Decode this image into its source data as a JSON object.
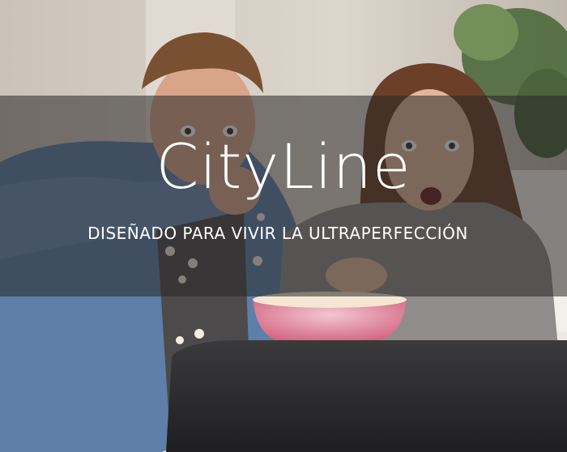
{
  "hero": {
    "title": "CityLine",
    "tagline": "DISEÑADO PARA VIVIR LA ULTRAPERFECCIÓN",
    "image": {
      "subject": "man-and-woman-eating-popcorn-watching-tv"
    }
  },
  "colors": {
    "overlay": "#282626",
    "text": "#ffffff",
    "wall": "#d8d2ca",
    "shirt_denim": "#5d7fa8",
    "sweater_grey": "#8f8c8b",
    "popcorn_bowl": "#d66a86",
    "tv": "#2e2e30"
  }
}
